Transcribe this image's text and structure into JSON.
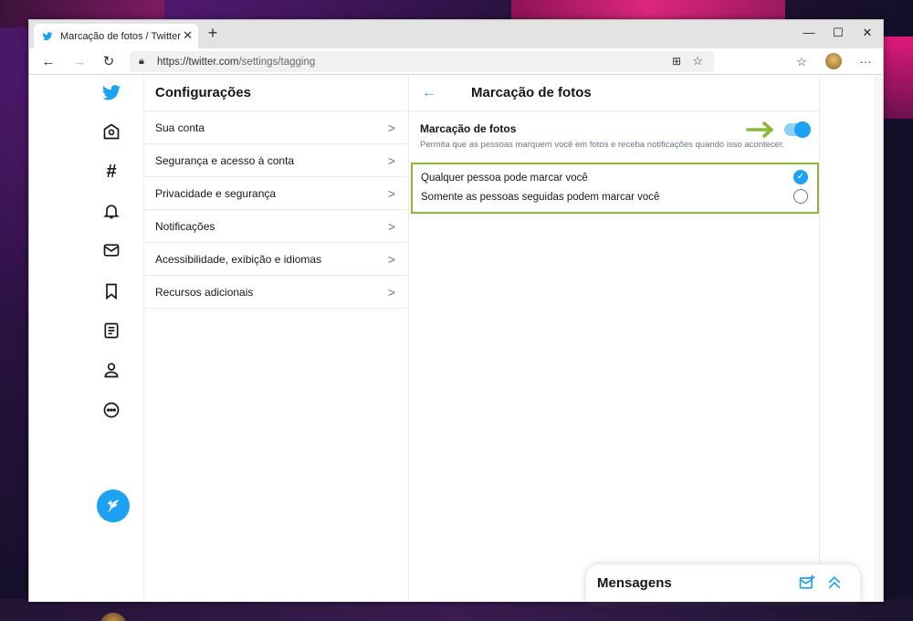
{
  "browser": {
    "tab_title": "Marcação de fotos / Twitter",
    "url_host": "https://twitter.com",
    "url_path": "/settings/tagging"
  },
  "settings_menu": {
    "title": "Configurações",
    "items": [
      {
        "label": "Sua conta"
      },
      {
        "label": "Segurança e acesso à conta"
      },
      {
        "label": "Privacidade e segurança"
      },
      {
        "label": "Notificações"
      },
      {
        "label": "Acessibilidade, exibição e idiomas"
      },
      {
        "label": "Recursos adicionais"
      }
    ]
  },
  "detail": {
    "title": "Marcação de fotos",
    "setting_title": "Marcação de fotos",
    "setting_desc": "Permita que as pessoas marquem você em fotos e receba notificações quando isso acontecer.",
    "toggle_on": true,
    "options": [
      {
        "label": "Qualquer pessoa pode marcar você",
        "selected": true
      },
      {
        "label": "Somente as pessoas seguidas podem marcar você",
        "selected": false
      }
    ]
  },
  "messages": {
    "title": "Mensagens"
  },
  "colors": {
    "accent": "#1da1f2",
    "highlight": "#8ab83a"
  }
}
